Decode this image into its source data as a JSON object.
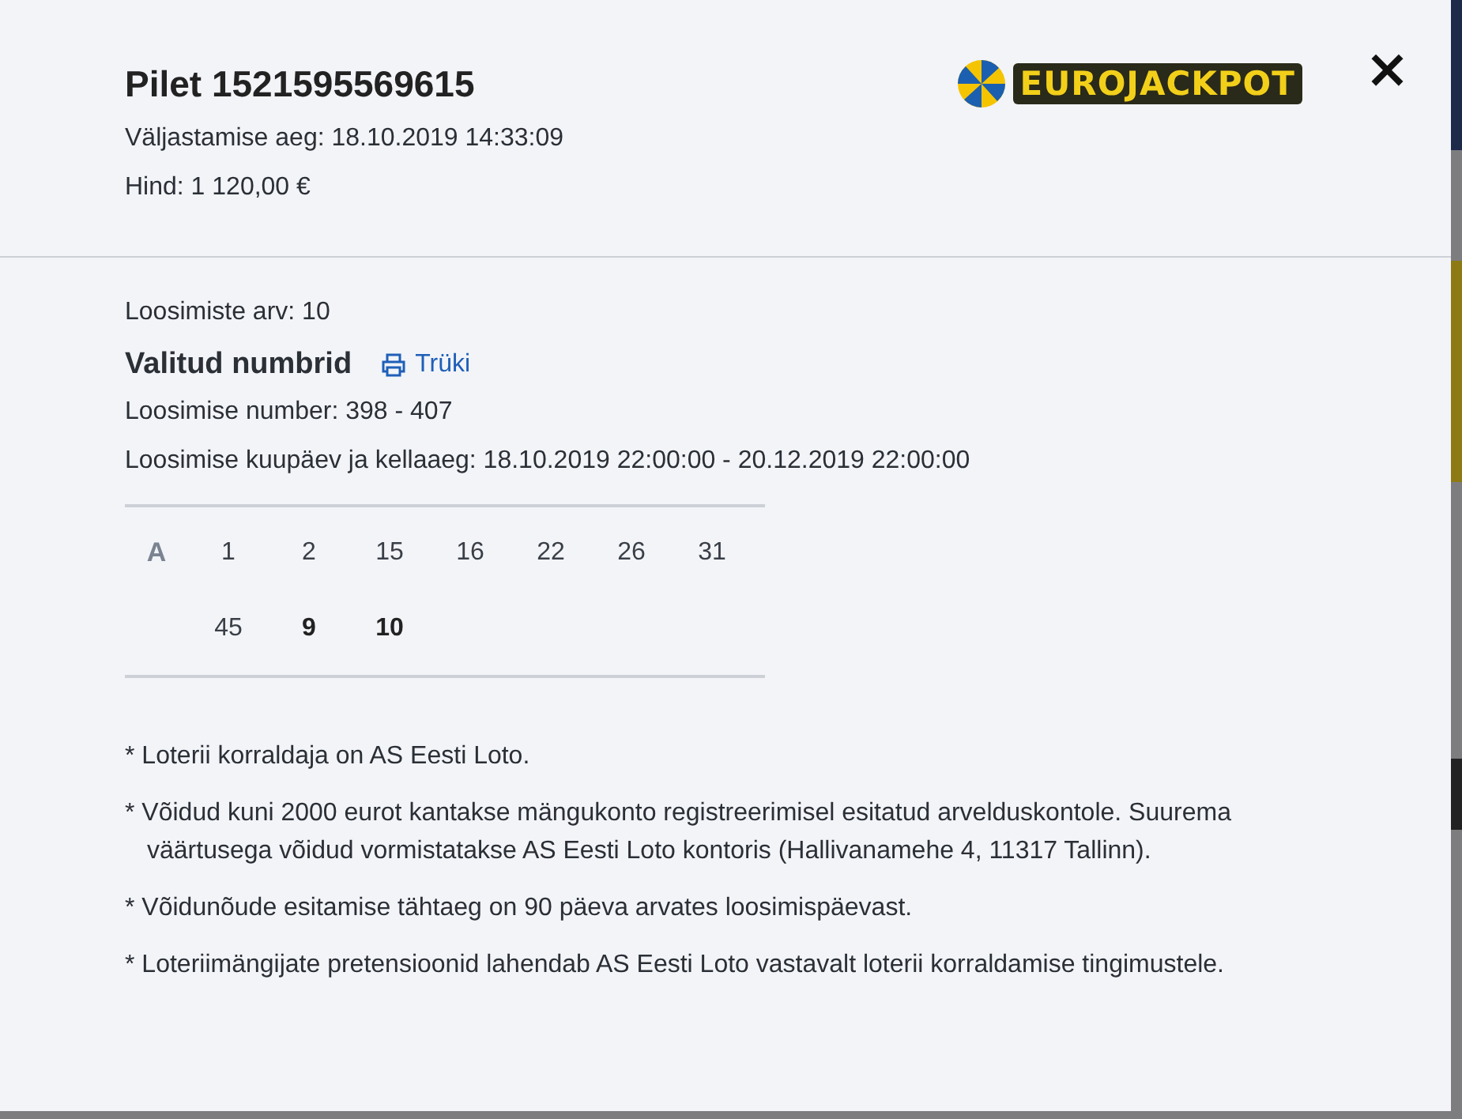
{
  "ticket": {
    "title": "Pilet 1521595569615",
    "issued": "Väljastamise aeg: 18.10.2019 14:33:09",
    "price": "Hind: 1 120,00 €",
    "logo": "EUROJACKPOT",
    "close": "×"
  },
  "details": {
    "draw_count": "Loosimiste arv: 10",
    "section_title": "Valitud numbrid",
    "print_link": "Trüki",
    "draw_numbers": "Loosimise number: 398 - 407",
    "draw_dates": "Loosimise kuupäev ja kellaaeg: 18.10.2019 22:00:00 - 20.12.2019 22:00:00"
  },
  "numbers": {
    "row_label": "A",
    "rows": [
      [
        {
          "value": "1",
          "kind": "main"
        },
        {
          "value": "2",
          "kind": "main"
        },
        {
          "value": "15",
          "kind": "main"
        },
        {
          "value": "16",
          "kind": "main"
        },
        {
          "value": "22",
          "kind": "main"
        },
        {
          "value": "26",
          "kind": "main"
        },
        {
          "value": "31",
          "kind": "main"
        }
      ],
      [
        {
          "value": "45",
          "kind": "main"
        },
        {
          "value": "9",
          "kind": "euro"
        },
        {
          "value": "10",
          "kind": "euro"
        }
      ]
    ]
  },
  "notes": [
    "* Loterii korraldaja on AS Eesti Loto.",
    "* Võidud kuni 2000 eurot kantakse mängukonto registreerimisel esitatud arvelduskontole. Suurema väärtusega võidud vormistatakse AS Eesti Loto kontoris (Hallivanamehe 4, 11317 Tallinn).",
    "* Võidunõude esitamise tähtaeg on 90 päeva arvates loosimispäevast.",
    "* Loteriimängijate pretensioonid lahendab AS Eesti Loto vastavalt loterii korraldamise tingimustele."
  ]
}
